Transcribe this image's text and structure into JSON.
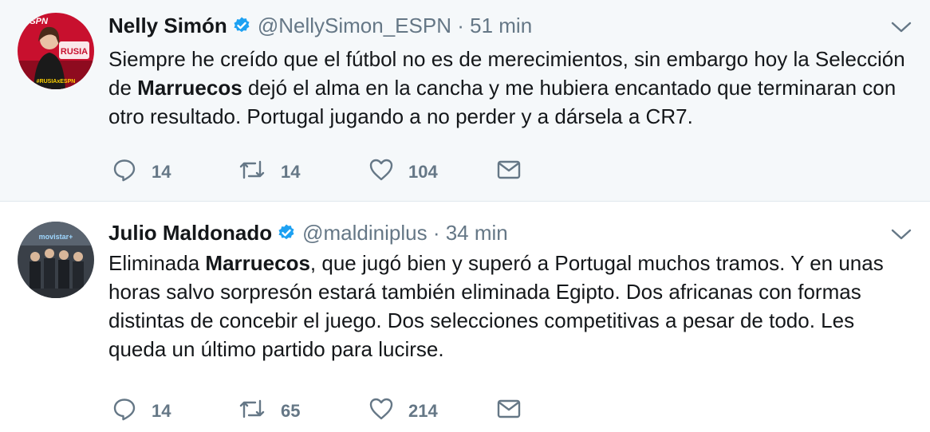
{
  "colors": {
    "text": "#14171a",
    "secondary": "#657786",
    "verified": "#1da1f2",
    "highlight_bg": "#f5f8fa"
  },
  "tweets": [
    {
      "name": "Nelly Simón",
      "verified": true,
      "handle": "@NellySimon_ESPN",
      "separator": "·",
      "time": "51 min",
      "text_parts": [
        "Siempre he creído que el fútbol no es de merecimientos, sin embargo hoy la Selección de ",
        "Marruecos",
        " dejó el alma en la cancha y me hubiera encantado que terminaran con otro resultado. Portugal jugando a no perder y a dársela a CR7."
      ],
      "replies": "14",
      "retweets": "14",
      "likes": "104",
      "avatar_text": {
        "brand": "ESPN",
        "badge": "RUSIA",
        "tag": "#RUSIAxESPN"
      }
    },
    {
      "name": "Julio Maldonado",
      "verified": true,
      "handle": "@maldiniplus",
      "separator": "·",
      "time": "34 min",
      "text_parts": [
        "Eliminada ",
        "Marruecos",
        ", que jugó bien y superó a Portugal muchos tramos. Y en unas horas salvo sorpresón estará también eliminada Egipto. Dos africanas con formas distintas de concebir el juego. Dos selecciones competitivas a pesar de todo. Les queda un último partido para lucirse."
      ],
      "replies": "14",
      "retweets": "65",
      "likes": "214",
      "avatar_text": {
        "brand": "movistar+"
      }
    }
  ],
  "icons": {
    "reply": "reply-icon",
    "retweet": "retweet-icon",
    "like": "heart-icon",
    "dm": "envelope-icon",
    "verified": "verified-badge-icon",
    "caret": "chevron-down-icon"
  }
}
